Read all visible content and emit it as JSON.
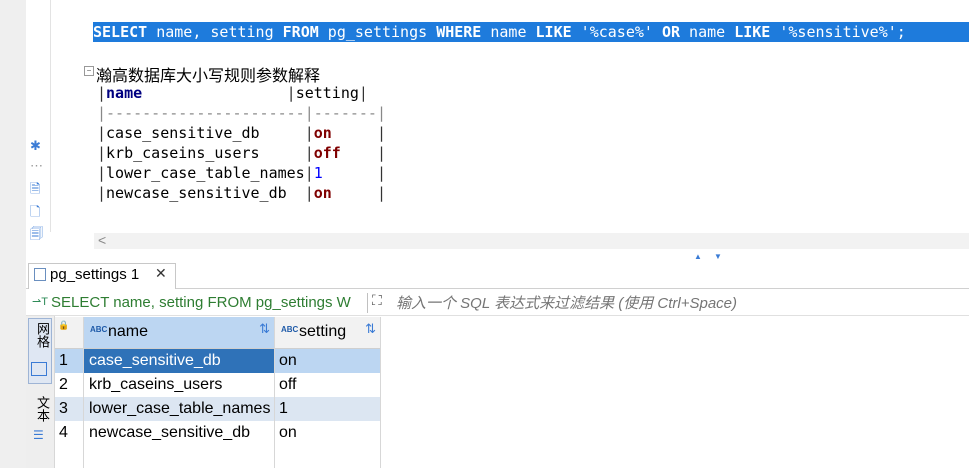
{
  "editor": {
    "sql_parts": [
      "SELECT",
      " name, ",
      "setting ",
      "FROM",
      " pg_settings ",
      "WHERE",
      " name ",
      "LIKE",
      " '%case%' ",
      "OR",
      " name ",
      "LIKE",
      " '%sensitive%';"
    ],
    "comment_title": "瀚高数据库大小写规则参数解释",
    "md_table": {
      "header": [
        "name",
        "setting"
      ],
      "separator": [
        "----------------------",
        "-------"
      ],
      "rows": [
        {
          "name": "case_sensitive_db",
          "setting": "on"
        },
        {
          "name": "krb_caseins_users",
          "setting": "off"
        },
        {
          "name": "lower_case_table_names",
          "setting": "1"
        },
        {
          "name": "newcase_sensitive_db",
          "setting": "on"
        }
      ]
    }
  },
  "results": {
    "tab_label": "pg_settings 1",
    "filter_sql": "SELECT name, setting FROM pg_settings W",
    "filter_placeholder": "输入一个 SQL 表达式来过滤结果 (使用 Ctrl+Space)",
    "side_tabs": {
      "grid": "网格",
      "text": "文本"
    },
    "columns": [
      {
        "type": "ABC",
        "label": "name"
      },
      {
        "type": "ABC",
        "label": "setting"
      }
    ],
    "rows": [
      {
        "num": "1",
        "name": "case_sensitive_db",
        "setting": "on"
      },
      {
        "num": "2",
        "name": "krb_caseins_users",
        "setting": "off"
      },
      {
        "num": "3",
        "name": "lower_case_table_names",
        "setting": "1"
      },
      {
        "num": "4",
        "name": "newcase_sensitive_db",
        "setting": "on"
      }
    ]
  }
}
